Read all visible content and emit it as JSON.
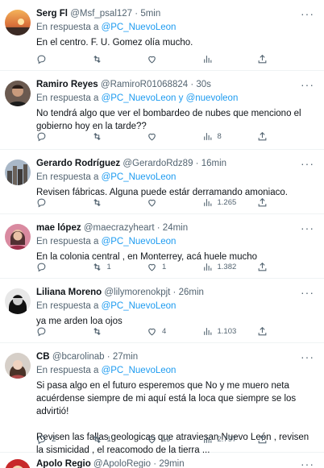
{
  "tweets": [
    {
      "name": "Serg Fl",
      "handle": "@Msf_psal127",
      "time": "5min",
      "reply_prefix": "En respuesta a",
      "mentions": [
        "@PC_NuevoLeon"
      ],
      "mention_join": "",
      "text": [
        "En el centro. F. U. Gomez olía mucho."
      ],
      "counts": {
        "reply": "",
        "retweet": "",
        "like": "",
        "views": ""
      },
      "avatar": "sunset"
    },
    {
      "name": "Ramiro Reyes",
      "handle": "@RamiroR01068824",
      "time": "30s",
      "reply_prefix": "En respuesta a",
      "mentions": [
        "@PC_NuevoLeon",
        "@nuevoleon"
      ],
      "mention_join": "y",
      "text": [
        "No tendrá algo que ver el bombardeo de nubes que menciono el gobierno hoy en la tarde??"
      ],
      "counts": {
        "reply": "",
        "retweet": "",
        "like": "",
        "views": "8"
      },
      "avatar": "person-dark"
    },
    {
      "name": "Gerardo Rodríguez",
      "handle": "@GerardoRdz89",
      "time": "16min",
      "reply_prefix": "En respuesta a",
      "mentions": [
        "@PC_NuevoLeon"
      ],
      "mention_join": "",
      "text": [
        "Revisen fábricas. Alguna puede estár derramando amoniaco."
      ],
      "counts": {
        "reply": "",
        "retweet": "",
        "like": "",
        "views": "1.265"
      },
      "avatar": "building"
    },
    {
      "name": "mae lópez",
      "handle": "@maecrazyheart",
      "time": "24min",
      "reply_prefix": "En respuesta a",
      "mentions": [
        "@PC_NuevoLeon"
      ],
      "mention_join": "",
      "text": [
        "En la colonia central , en Monterrey,  acá huele mucho"
      ],
      "counts": {
        "reply": "",
        "retweet": "1",
        "like": "1",
        "views": "1.382"
      },
      "avatar": "person-pink"
    },
    {
      "name": "Liliana Moreno",
      "handle": "@lilymorenokpjt",
      "time": "26min",
      "reply_prefix": "En respuesta a",
      "mentions": [
        "@PC_NuevoLeon"
      ],
      "mention_join": "",
      "text": [
        "ya me arden loa ojos"
      ],
      "counts": {
        "reply": "",
        "retweet": "",
        "like": "4",
        "views": "1.103"
      },
      "avatar": "person-bw"
    },
    {
      "name": "CB",
      "handle": "@bcarolinab",
      "time": "27min",
      "reply_prefix": "En respuesta a",
      "mentions": [
        "@PC_NuevoLeon"
      ],
      "mention_join": "",
      "text": [
        "Si pasa algo en el futuro esperemos que No y me muero neta acuérdense siempre de mi aquí está la loca que siempre se los advirtió!",
        "Revisen las fallas geologicas que atraviesan Nuevo León , revisen la sismicidad , el reacomodo de la tierra ..."
      ],
      "counts": {
        "reply": "2",
        "retweet": "1",
        "like": "19",
        "views": "2.797"
      },
      "avatar": "person-light"
    },
    {
      "name": "Apolo Regio",
      "handle": "@ApoloRegio",
      "time": "29min",
      "reply_prefix": "",
      "mentions": [],
      "mention_join": "",
      "text": [],
      "counts": {
        "reply": "",
        "retweet": "",
        "like": "",
        "views": ""
      },
      "avatar": "red"
    }
  ],
  "dot": "·",
  "colors": {
    "accent": "#1d9bf0",
    "muted": "#536471",
    "text": "#0f1419",
    "divider": "#eff3f4"
  },
  "icons": [
    "reply-icon",
    "retweet-icon",
    "like-icon",
    "views-icon",
    "share-icon",
    "more-icon"
  ]
}
